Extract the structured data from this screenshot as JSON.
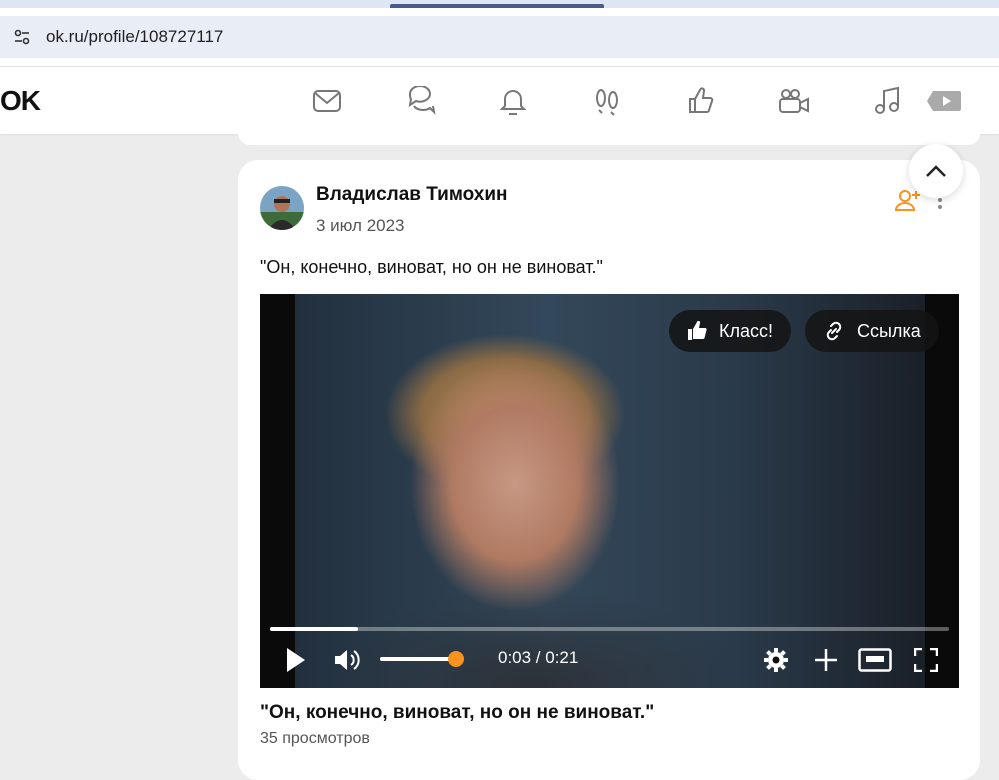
{
  "browser": {
    "url": "ok.ru/profile/108727117"
  },
  "header": {
    "logo": "OK",
    "nav_icons": [
      "mail-icon",
      "chat-icon",
      "bell-icon",
      "footprints-icon",
      "like-icon",
      "video-camera-icon",
      "music-icon",
      "video-play-icon"
    ]
  },
  "post": {
    "author": "Владислав Тимохин",
    "date": "3 июл 2023",
    "text": "\"Он, конечно, виноват, но он не виноват.\"",
    "video": {
      "like_label": "Класс!",
      "link_label": "Ссылка",
      "time": "0:03 / 0:21",
      "progress": 0.13,
      "volume": 0.95,
      "title": "\"Он, конечно, виноват, но он не виноват.\"",
      "views": "35 просмотров"
    }
  },
  "colors": {
    "accent": "#f7931e",
    "background": "#ececec"
  }
}
